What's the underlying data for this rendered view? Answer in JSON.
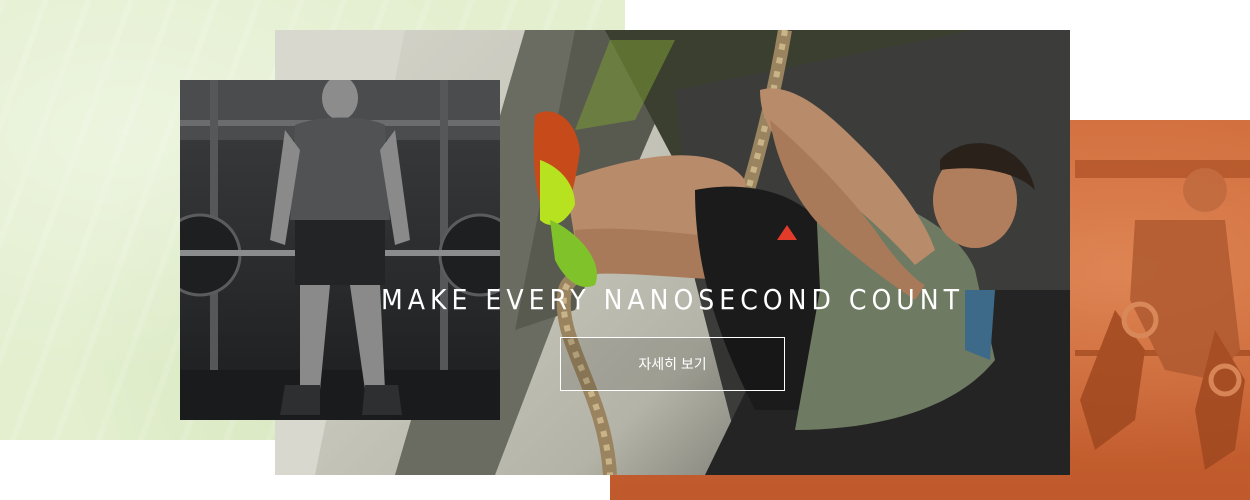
{
  "banner": {
    "headline": "MAKE EVERY NANOSECOND COUNT",
    "cta_label": "자세히 보기"
  },
  "colors": {
    "left_panel": "#e3efcf",
    "right_panel": "#c05a2c",
    "text": "#ffffff",
    "shoe_accent": "#b6e21f"
  },
  "icons": [
    "reebok-delta-logo-icon"
  ]
}
